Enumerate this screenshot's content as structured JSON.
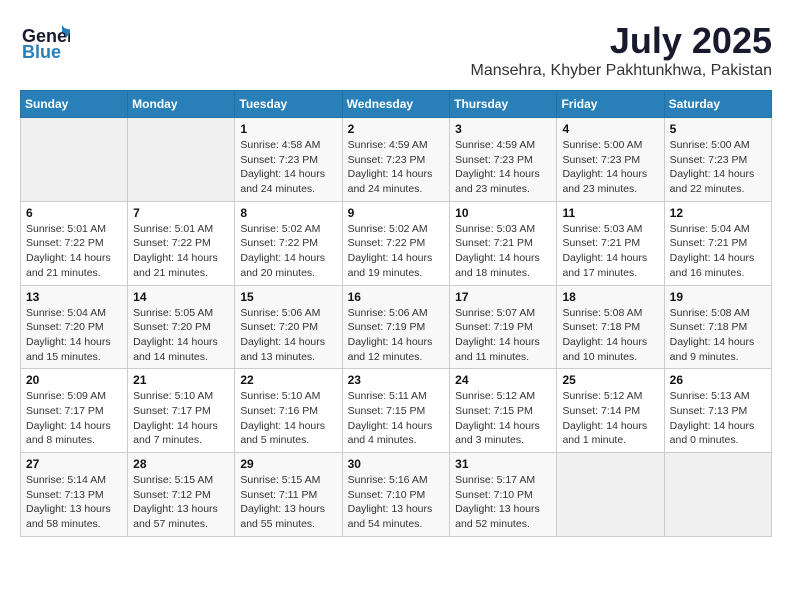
{
  "header": {
    "logo_general": "General",
    "logo_blue": "Blue",
    "month_year": "July 2025",
    "location": "Mansehra, Khyber Pakhtunkhwa, Pakistan"
  },
  "weekdays": [
    "Sunday",
    "Monday",
    "Tuesday",
    "Wednesday",
    "Thursday",
    "Friday",
    "Saturday"
  ],
  "weeks": [
    [
      {
        "day": "",
        "sunrise": "",
        "sunset": "",
        "daylight": ""
      },
      {
        "day": "",
        "sunrise": "",
        "sunset": "",
        "daylight": ""
      },
      {
        "day": "1",
        "sunrise": "Sunrise: 4:58 AM",
        "sunset": "Sunset: 7:23 PM",
        "daylight": "Daylight: 14 hours and 24 minutes."
      },
      {
        "day": "2",
        "sunrise": "Sunrise: 4:59 AM",
        "sunset": "Sunset: 7:23 PM",
        "daylight": "Daylight: 14 hours and 24 minutes."
      },
      {
        "day": "3",
        "sunrise": "Sunrise: 4:59 AM",
        "sunset": "Sunset: 7:23 PM",
        "daylight": "Daylight: 14 hours and 23 minutes."
      },
      {
        "day": "4",
        "sunrise": "Sunrise: 5:00 AM",
        "sunset": "Sunset: 7:23 PM",
        "daylight": "Daylight: 14 hours and 23 minutes."
      },
      {
        "day": "5",
        "sunrise": "Sunrise: 5:00 AM",
        "sunset": "Sunset: 7:23 PM",
        "daylight": "Daylight: 14 hours and 22 minutes."
      }
    ],
    [
      {
        "day": "6",
        "sunrise": "Sunrise: 5:01 AM",
        "sunset": "Sunset: 7:22 PM",
        "daylight": "Daylight: 14 hours and 21 minutes."
      },
      {
        "day": "7",
        "sunrise": "Sunrise: 5:01 AM",
        "sunset": "Sunset: 7:22 PM",
        "daylight": "Daylight: 14 hours and 21 minutes."
      },
      {
        "day": "8",
        "sunrise": "Sunrise: 5:02 AM",
        "sunset": "Sunset: 7:22 PM",
        "daylight": "Daylight: 14 hours and 20 minutes."
      },
      {
        "day": "9",
        "sunrise": "Sunrise: 5:02 AM",
        "sunset": "Sunset: 7:22 PM",
        "daylight": "Daylight: 14 hours and 19 minutes."
      },
      {
        "day": "10",
        "sunrise": "Sunrise: 5:03 AM",
        "sunset": "Sunset: 7:21 PM",
        "daylight": "Daylight: 14 hours and 18 minutes."
      },
      {
        "day": "11",
        "sunrise": "Sunrise: 5:03 AM",
        "sunset": "Sunset: 7:21 PM",
        "daylight": "Daylight: 14 hours and 17 minutes."
      },
      {
        "day": "12",
        "sunrise": "Sunrise: 5:04 AM",
        "sunset": "Sunset: 7:21 PM",
        "daylight": "Daylight: 14 hours and 16 minutes."
      }
    ],
    [
      {
        "day": "13",
        "sunrise": "Sunrise: 5:04 AM",
        "sunset": "Sunset: 7:20 PM",
        "daylight": "Daylight: 14 hours and 15 minutes."
      },
      {
        "day": "14",
        "sunrise": "Sunrise: 5:05 AM",
        "sunset": "Sunset: 7:20 PM",
        "daylight": "Daylight: 14 hours and 14 minutes."
      },
      {
        "day": "15",
        "sunrise": "Sunrise: 5:06 AM",
        "sunset": "Sunset: 7:20 PM",
        "daylight": "Daylight: 14 hours and 13 minutes."
      },
      {
        "day": "16",
        "sunrise": "Sunrise: 5:06 AM",
        "sunset": "Sunset: 7:19 PM",
        "daylight": "Daylight: 14 hours and 12 minutes."
      },
      {
        "day": "17",
        "sunrise": "Sunrise: 5:07 AM",
        "sunset": "Sunset: 7:19 PM",
        "daylight": "Daylight: 14 hours and 11 minutes."
      },
      {
        "day": "18",
        "sunrise": "Sunrise: 5:08 AM",
        "sunset": "Sunset: 7:18 PM",
        "daylight": "Daylight: 14 hours and 10 minutes."
      },
      {
        "day": "19",
        "sunrise": "Sunrise: 5:08 AM",
        "sunset": "Sunset: 7:18 PM",
        "daylight": "Daylight: 14 hours and 9 minutes."
      }
    ],
    [
      {
        "day": "20",
        "sunrise": "Sunrise: 5:09 AM",
        "sunset": "Sunset: 7:17 PM",
        "daylight": "Daylight: 14 hours and 8 minutes."
      },
      {
        "day": "21",
        "sunrise": "Sunrise: 5:10 AM",
        "sunset": "Sunset: 7:17 PM",
        "daylight": "Daylight: 14 hours and 7 minutes."
      },
      {
        "day": "22",
        "sunrise": "Sunrise: 5:10 AM",
        "sunset": "Sunset: 7:16 PM",
        "daylight": "Daylight: 14 hours and 5 minutes."
      },
      {
        "day": "23",
        "sunrise": "Sunrise: 5:11 AM",
        "sunset": "Sunset: 7:15 PM",
        "daylight": "Daylight: 14 hours and 4 minutes."
      },
      {
        "day": "24",
        "sunrise": "Sunrise: 5:12 AM",
        "sunset": "Sunset: 7:15 PM",
        "daylight": "Daylight: 14 hours and 3 minutes."
      },
      {
        "day": "25",
        "sunrise": "Sunrise: 5:12 AM",
        "sunset": "Sunset: 7:14 PM",
        "daylight": "Daylight: 14 hours and 1 minute."
      },
      {
        "day": "26",
        "sunrise": "Sunrise: 5:13 AM",
        "sunset": "Sunset: 7:13 PM",
        "daylight": "Daylight: 14 hours and 0 minutes."
      }
    ],
    [
      {
        "day": "27",
        "sunrise": "Sunrise: 5:14 AM",
        "sunset": "Sunset: 7:13 PM",
        "daylight": "Daylight: 13 hours and 58 minutes."
      },
      {
        "day": "28",
        "sunrise": "Sunrise: 5:15 AM",
        "sunset": "Sunset: 7:12 PM",
        "daylight": "Daylight: 13 hours and 57 minutes."
      },
      {
        "day": "29",
        "sunrise": "Sunrise: 5:15 AM",
        "sunset": "Sunset: 7:11 PM",
        "daylight": "Daylight: 13 hours and 55 minutes."
      },
      {
        "day": "30",
        "sunrise": "Sunrise: 5:16 AM",
        "sunset": "Sunset: 7:10 PM",
        "daylight": "Daylight: 13 hours and 54 minutes."
      },
      {
        "day": "31",
        "sunrise": "Sunrise: 5:17 AM",
        "sunset": "Sunset: 7:10 PM",
        "daylight": "Daylight: 13 hours and 52 minutes."
      },
      {
        "day": "",
        "sunrise": "",
        "sunset": "",
        "daylight": ""
      },
      {
        "day": "",
        "sunrise": "",
        "sunset": "",
        "daylight": ""
      }
    ]
  ]
}
